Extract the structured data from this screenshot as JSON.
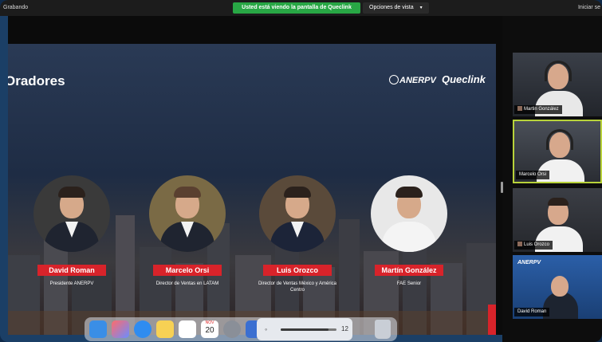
{
  "topbar": {
    "left_label": "Grabando",
    "share_banner": "Usted está viendo la pantalla de Queclink",
    "view_options": "Opciones de vista",
    "right_label": "Iniciar se"
  },
  "slide": {
    "title": "Oradores",
    "logo_left": "ANERPV",
    "logo_right": "Queclink",
    "speakers": [
      {
        "name": "David Roman",
        "role": "Presidente ANERPV"
      },
      {
        "name": "Marcelo Orsi",
        "role": "Director de Ventas en LATAM"
      },
      {
        "name": "Luis Orozco",
        "role": "Director de Ventas México y América Centro"
      },
      {
        "name": "Martín González",
        "role": "FAE Senior"
      }
    ]
  },
  "dock": {
    "calendar_month": "NOV",
    "calendar_day": "20",
    "volume_level": 0.85,
    "volume_value": "12"
  },
  "participants": [
    {
      "name": "Martin González",
      "active": false
    },
    {
      "name": "Marcelo Orsi",
      "active": true
    },
    {
      "name": "Luis Orozco",
      "active": false
    },
    {
      "name": "David Roman",
      "active": false,
      "banner": "ANERPV"
    }
  ],
  "colors": {
    "accent_red": "#d8232a",
    "share_green": "#28a745",
    "active_border": "#b8d23a"
  }
}
